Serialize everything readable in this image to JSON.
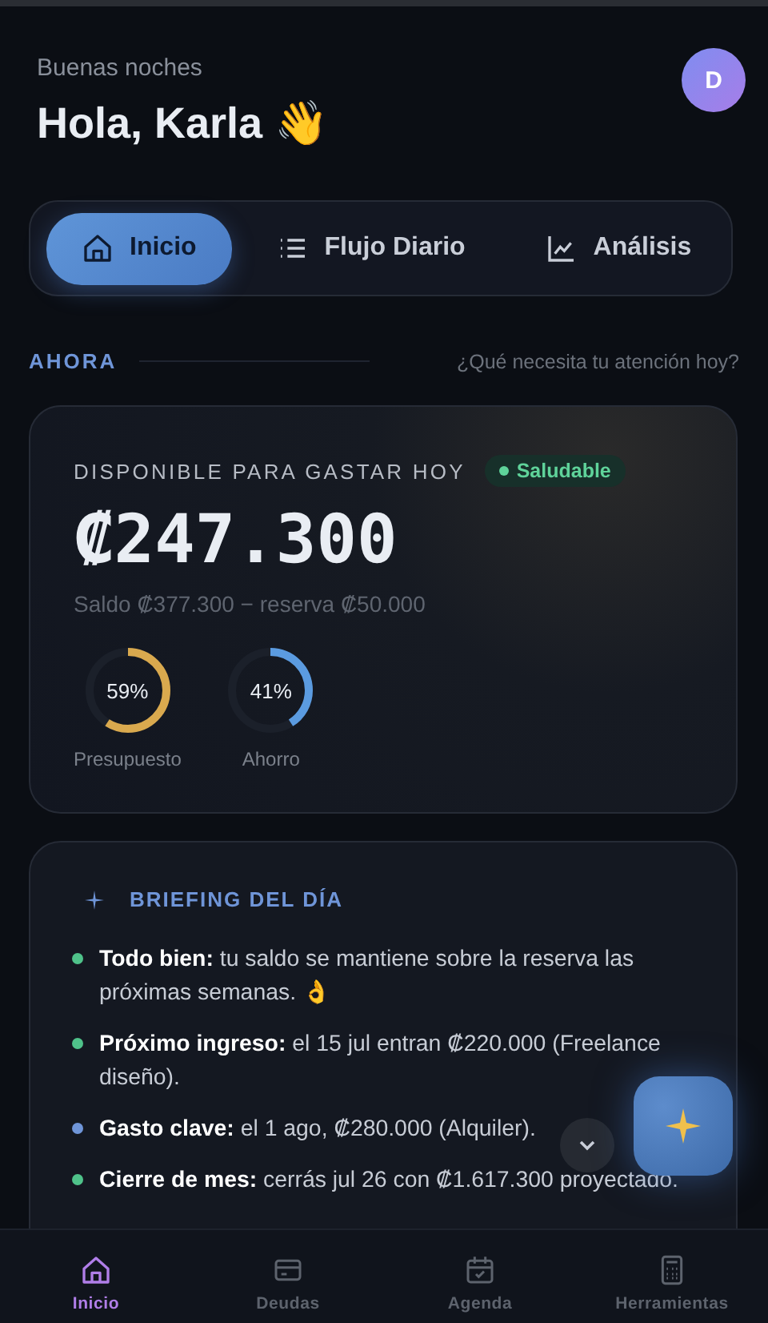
{
  "header": {
    "greeting": "Buenas noches",
    "title": "Hola, Karla 👋",
    "avatar": "D"
  },
  "tabs": [
    {
      "label": "Inicio",
      "selected": true
    },
    {
      "label": "Flujo Diario",
      "selected": false
    },
    {
      "label": "Análisis",
      "selected": false
    }
  ],
  "section": {
    "label": "AHORA",
    "hint": "¿Qué necesita tu atención hoy?"
  },
  "balance_card": {
    "label": "DISPONIBLE PARA GASTAR HOY",
    "status": "Saludable",
    "amount": "₡247.300",
    "detail": "Saldo ₡377.300 − reserva ₡50.000",
    "rings": [
      {
        "reading": "59%",
        "label": "Presupuesto",
        "level": 0.59,
        "color": "#d9a94e"
      },
      {
        "reading": "41%",
        "label": "Ahorro",
        "level": 0.41,
        "color": "#5b9be0"
      }
    ]
  },
  "briefing": {
    "title": "BRIEFING DEL DÍA",
    "items": [
      {
        "text": "**Todo bien:** tu saldo se mantiene sobre la reserva las próximas semanas. 👌",
        "color": "#4fc28a"
      },
      {
        "text": "**Próximo ingreso:** el 15 jul entran ₡220.000 (Freelance diseño).",
        "color": "#4fc28a"
      },
      {
        "text": "**Gasto clave:** el 1 ago, ₡280.000 (Alquiler).",
        "color": "#6f95d8"
      },
      {
        "text": "**Cierre de mes:** cerrás jul 26 con ₡1.617.300 proyectado.",
        "color": "#4fc28a"
      }
    ]
  },
  "nav": [
    {
      "label": "Inicio",
      "selected": true
    },
    {
      "label": "Deudas",
      "selected": false
    },
    {
      "label": "Agenda",
      "selected": false
    },
    {
      "label": "Herramientas",
      "selected": false
    }
  ]
}
